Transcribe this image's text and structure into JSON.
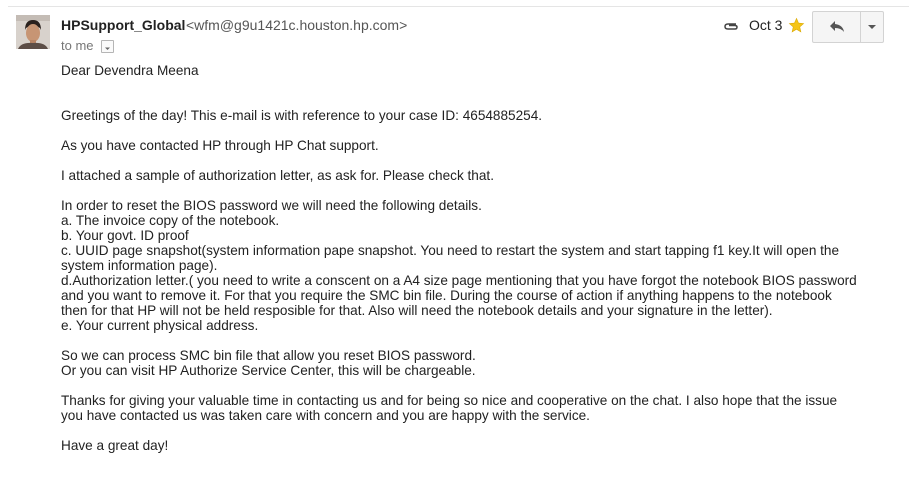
{
  "header": {
    "sender_name": "HPSupport_Global",
    "sender_email": "<wfm@g9u1421c.houston.hp.com>",
    "to_label": "to me",
    "date": "Oct 3",
    "star_color": "#f5c518",
    "icons": [
      "paperclip-icon",
      "star-icon",
      "reply-icon",
      "chevron-down-icon"
    ]
  },
  "body": {
    "greeting": "Dear Devendra Meena",
    "intro": "Greetings of the day! This e-mail is with reference to your case ID: 4654885254.",
    "contact": "As you have contacted HP through HP Chat support.",
    "attached": "I attached a sample of authorization letter, as ask for. Please check that.",
    "details_lines": [
      "In order to reset the BIOS password we will need the following details.",
      "a. The invoice copy of the notebook.",
      "b. Your govt. ID proof",
      "c. UUID page snapshot(system information pape snapshot. You need to restart the system and start tapping f1 key.It will open the system information page).",
      "d.Authorization letter.( you need to write a conscent on a A4 size page mentioning that you have forgot the notebook BIOS password and you want to remove it. For that you require the SMC bin file. During the course of action if anything happens to the notebook then for that HP will not be held resposible for that. Also will need the notebook details and your signature in the letter).",
      "e. Your current physical address."
    ],
    "process_lines": [
      "So we can process SMC bin file that allow you reset BIOS password.",
      "Or you can visit HP Authorize Service Center, this will be chargeable."
    ],
    "thanks": "Thanks for giving your valuable time in contacting us and for being so nice and cooperative on the chat. I also hope that the issue you have contacted us was taken care with concern and you are happy with the service.",
    "closing": "Have a great day!"
  }
}
